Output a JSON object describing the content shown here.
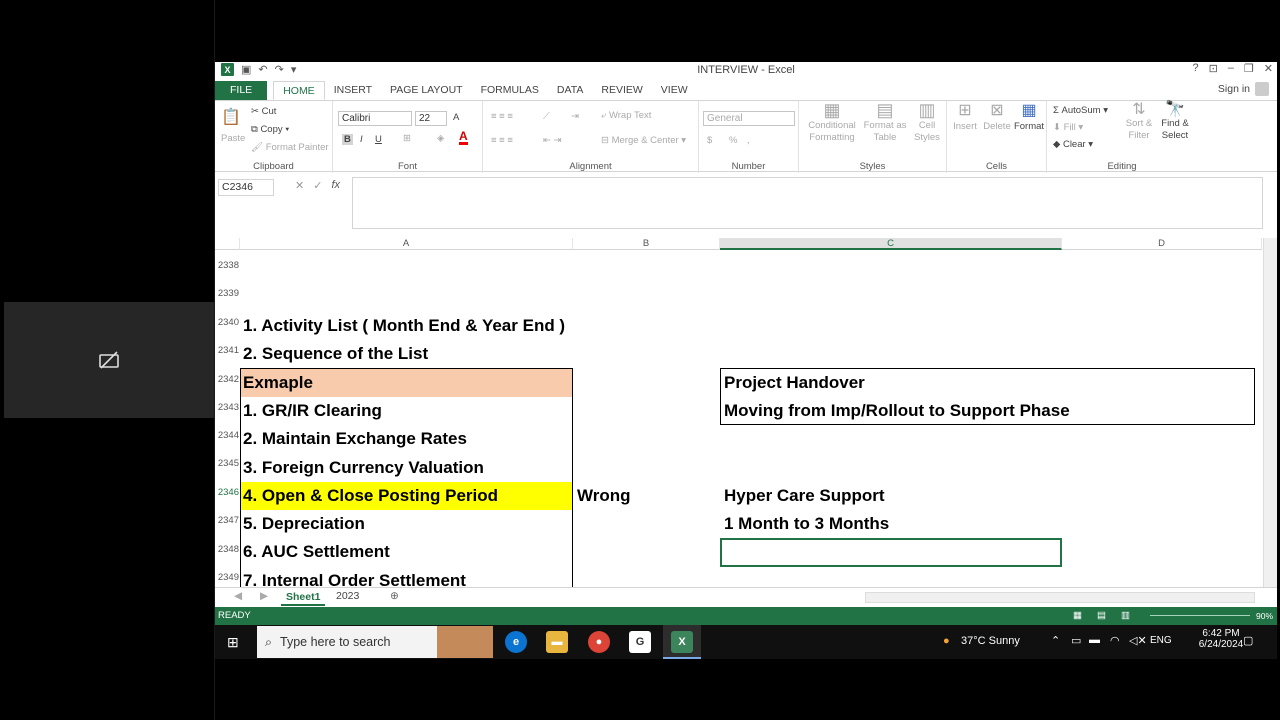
{
  "window": {
    "title": "INTERVIEW - Excel",
    "help": "?",
    "controls": [
      "⊡",
      "–",
      "❐",
      "✕"
    ]
  },
  "ribbon_tabs": [
    "FILE",
    "HOME",
    "INSERT",
    "PAGE LAYOUT",
    "FORMULAS",
    "DATA",
    "REVIEW",
    "VIEW"
  ],
  "signin": "Sign in",
  "clipboard": {
    "paste": "Paste",
    "cut": "Cut",
    "copy": "Copy",
    "format_painter": "Format Painter",
    "label": "Clipboard"
  },
  "font": {
    "name": "Calibri",
    "size": "22",
    "bold": "B",
    "italic": "I",
    "underline": "U",
    "grow": "A",
    "color": "A",
    "label": "Font"
  },
  "alignment": {
    "wrap": "Wrap Text",
    "merge": "Merge & Center",
    "label": "Alignment"
  },
  "number": {
    "format": "General",
    "currency": "$",
    "percent": "%",
    "comma": ",",
    "label": "Number"
  },
  "styles": {
    "conditional": "Conditional Formatting",
    "table": "Format as Table",
    "cell": "Cell Styles",
    "label": "Styles"
  },
  "cells": {
    "insert": "Insert",
    "delete": "Delete",
    "format": "Format",
    "label": "Cells"
  },
  "editing": {
    "autosum": "AutoSum",
    "fill": "Fill",
    "clear": "Clear",
    "sort": "Sort & Filter",
    "find": "Find & Select",
    "label": "Editing"
  },
  "formula_bar": {
    "name_box": "C2346",
    "fx": "fx",
    "value": ""
  },
  "columns": [
    "A",
    "B",
    "C",
    "D"
  ],
  "rows": [
    "2338",
    "2339",
    "2340",
    "2341",
    "2342",
    "2343",
    "2344",
    "2345",
    "2346",
    "2347",
    "2348",
    "2349"
  ],
  "cells_data": {
    "a2338": "1. Activity List ( Month End & Year End )",
    "a2339": "2. Sequence of the List",
    "a2340": "Exmaple",
    "a2341": "1. GR/IR Clearing",
    "a2342": "2. Maintain Exchange Rates",
    "a2343": "3. Foreign Currency Valuation",
    "a2344": "4. Open & Close Posting Period",
    "b2344": "Wrong",
    "a2345": "5. Depreciation",
    "a2346": "6. AUC Settlement",
    "a2347": "7. Internal Order Settlement",
    "c2340": "Project Handover",
    "c2341": "Moving from Imp/Rollout to Support Phase",
    "c2344": "Hyper Care Support",
    "c2345": "1 Month to 3 Months"
  },
  "sheets": [
    "Sheet1",
    "2023"
  ],
  "status": {
    "ready": "READY",
    "zoom": "90%"
  },
  "taskbar": {
    "search_placeholder": "Type here to search",
    "weather": "37°C  Sunny",
    "lang": "ENG",
    "time": "6:42 PM",
    "date": "6/24/2024"
  },
  "colors": {
    "excel_green": "#217346",
    "highlight_yellow": "#ffff00",
    "header_peach": "#f8cbad"
  }
}
